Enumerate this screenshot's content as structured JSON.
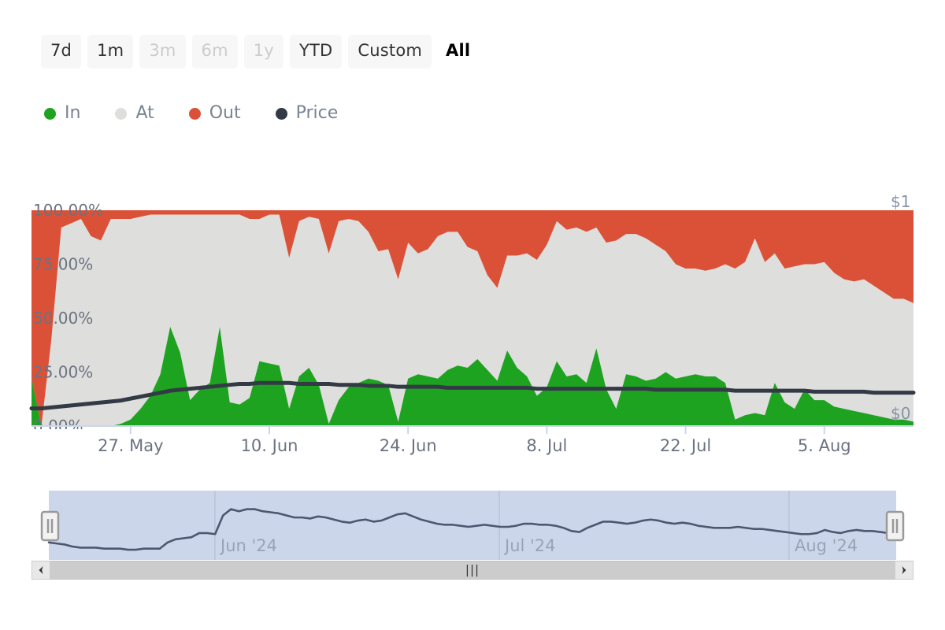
{
  "range_selector": {
    "buttons": [
      {
        "label": "7d",
        "state": "enabled"
      },
      {
        "label": "1m",
        "state": "enabled"
      },
      {
        "label": "3m",
        "state": "disabled"
      },
      {
        "label": "6m",
        "state": "disabled"
      },
      {
        "label": "1y",
        "state": "disabled"
      },
      {
        "label": "YTD",
        "state": "enabled"
      },
      {
        "label": "Custom",
        "state": "enabled"
      },
      {
        "label": "All",
        "state": "selected"
      }
    ]
  },
  "legend": {
    "items": [
      {
        "label": "In",
        "color": "#1ea320",
        "icon": "legend-dot-icon"
      },
      {
        "label": "At",
        "color": "#dededc",
        "icon": "legend-dot-icon"
      },
      {
        "label": "Out",
        "color": "#da5138",
        "icon": "legend-dot-icon"
      },
      {
        "label": "Price",
        "color": "#333a45",
        "icon": "legend-dot-icon"
      }
    ]
  },
  "y_axis": {
    "labels": [
      "0.00%",
      "25.00%",
      "50.00%",
      "75.00%",
      "100.00%"
    ],
    "min": 0,
    "max": 100,
    "unit": "%"
  },
  "price_axis": {
    "top_label": "$1",
    "bottom_label": "$0"
  },
  "x_axis": {
    "labels": [
      "27. May",
      "10. Jun",
      "24. Jun",
      "8. Jul",
      "22. Jul",
      "5. Aug"
    ]
  },
  "navigator": {
    "month_labels": [
      "Jun '24",
      "Jul '24",
      "Aug '24"
    ],
    "left_handle": "||",
    "right_handle": "||",
    "selection_color": "#ccd6eb"
  },
  "scrollbar": {
    "left_arrow": "◄",
    "right_arrow": "►",
    "grip": "|||"
  },
  "colors": {
    "in": "#1ea320",
    "at": "#dededc",
    "out": "#da5138",
    "price": "#333a45",
    "axis_text": "#6b7280",
    "legend_text": "#7b8394",
    "navigator_line": "#4d5870",
    "navigator_fill": "#ccd6eb"
  },
  "chart_data": {
    "type": "area",
    "title": "",
    "subtitle": "",
    "xlabel": "",
    "ylabel": "",
    "ylim": [
      0,
      100
    ],
    "grid": false,
    "stacked": true,
    "stack_type": "percent",
    "legend_position": "top-left",
    "x_tick_labels": [
      "27. May",
      "10. Jun",
      "24. Jun",
      "8. Jul",
      "22. Jul",
      "5. Aug"
    ],
    "y_tick_labels": [
      "0.00%",
      "25.00%",
      "50.00%",
      "75.00%",
      "100.00%"
    ],
    "x": [
      "17. May",
      "18. May",
      "19. May",
      "20. May",
      "21. May",
      "22. May",
      "23. May",
      "24. May",
      "25. May",
      "26. May",
      "27. May",
      "28. May",
      "29. May",
      "30. May",
      "31. May",
      "1. Jun",
      "2. Jun",
      "3. Jun",
      "4. Jun",
      "5. Jun",
      "6. Jun",
      "7. Jun",
      "8. Jun",
      "9. Jun",
      "10. Jun",
      "11. Jun",
      "12. Jun",
      "13. Jun",
      "14. Jun",
      "15. Jun",
      "16. Jun",
      "17. Jun",
      "18. Jun",
      "19. Jun",
      "20. Jun",
      "21. Jun",
      "22. Jun",
      "23. Jun",
      "24. Jun",
      "25. Jun",
      "26. Jun",
      "27. Jun",
      "28. Jun",
      "29. Jun",
      "30. Jun",
      "1. Jul",
      "2. Jul",
      "3. Jul",
      "4. Jul",
      "5. Jul",
      "6. Jul",
      "7. Jul",
      "8. Jul",
      "9. Jul",
      "10. Jul",
      "11. Jul",
      "12. Jul",
      "13. Jul",
      "14. Jul",
      "15. Jul",
      "16. Jul",
      "17. Jul",
      "18. Jul",
      "19. Jul",
      "20. Jul",
      "21. Jul",
      "22. Jul",
      "23. Jul",
      "24. Jul",
      "25. Jul",
      "26. Jul",
      "27. Jul",
      "28. Jul",
      "29. Jul",
      "30. Jul",
      "31. Jul",
      "1. Aug",
      "2. Aug",
      "3. Aug",
      "4. Aug",
      "5. Aug",
      "6. Aug",
      "7. Aug",
      "8. Aug",
      "9. Aug",
      "10. Aug",
      "11. Aug",
      "12. Aug",
      "13. Aug",
      "14. Aug"
    ],
    "series": [
      {
        "name": "In",
        "color": "#1ea320",
        "values": [
          22,
          0,
          0,
          0,
          0,
          0,
          0,
          0,
          0,
          1,
          3,
          8,
          14,
          24,
          46,
          34,
          12,
          17,
          20,
          46,
          11,
          10,
          13,
          30,
          29,
          28,
          8,
          23,
          27,
          19,
          1,
          12,
          18,
          20,
          22,
          21,
          19,
          2,
          22,
          24,
          23,
          22,
          26,
          28,
          27,
          31,
          26,
          21,
          35,
          27,
          23,
          14,
          18,
          30,
          23,
          24,
          20,
          36,
          17,
          8,
          24,
          23,
          21,
          22,
          25,
          22,
          23,
          24,
          23,
          23,
          20,
          3,
          5,
          6,
          5,
          20,
          11,
          8,
          17,
          12,
          12,
          9,
          8,
          7,
          6,
          5,
          4,
          3,
          3,
          2
        ]
      },
      {
        "name": "At",
        "color": "#dededc",
        "values": [
          0,
          0,
          40,
          92,
          94,
          96,
          88,
          86,
          96,
          95,
          93,
          89,
          84,
          74,
          52,
          64,
          86,
          81,
          78,
          52,
          87,
          88,
          83,
          66,
          69,
          70,
          70,
          72,
          70,
          77,
          79,
          83,
          78,
          75,
          68,
          60,
          63,
          66,
          63,
          56,
          59,
          66,
          64,
          62,
          56,
          50,
          44,
          43,
          44,
          52,
          57,
          63,
          66,
          65,
          68,
          68,
          70,
          56,
          68,
          78,
          65,
          66,
          66,
          62,
          56,
          53,
          50,
          49,
          49,
          50,
          55,
          70,
          71,
          81,
          71,
          60,
          62,
          66,
          58,
          63,
          64,
          62,
          60,
          60,
          62,
          60,
          58,
          56,
          56,
          55
        ]
      },
      {
        "name": "Out",
        "color": "#da5138",
        "values": [
          78,
          100,
          60,
          8,
          6,
          4,
          12,
          14,
          4,
          4,
          4,
          3,
          2,
          2,
          2,
          2,
          2,
          2,
          2,
          2,
          2,
          2,
          4,
          4,
          2,
          2,
          22,
          5,
          3,
          4,
          20,
          5,
          4,
          5,
          10,
          19,
          18,
          32,
          15,
          20,
          18,
          12,
          10,
          10,
          17,
          19,
          30,
          36,
          21,
          21,
          20,
          23,
          16,
          5,
          9,
          8,
          10,
          8,
          15,
          14,
          11,
          11,
          13,
          16,
          19,
          25,
          27,
          27,
          28,
          27,
          25,
          27,
          24,
          13,
          24,
          20,
          27,
          26,
          25,
          25,
          24,
          29,
          32,
          33,
          32,
          35,
          38,
          41,
          41,
          43
        ]
      },
      {
        "name": "Price",
        "color": "#333a45",
        "type": "line",
        "axis": "right",
        "values": [
          1.8,
          1.8,
          1.9,
          2.0,
          2.1,
          2.2,
          2.3,
          2.4,
          2.5,
          2.6,
          2.8,
          3.0,
          3.2,
          3.4,
          3.6,
          3.7,
          3.8,
          3.9,
          4.0,
          4.1,
          4.2,
          4.3,
          4.3,
          4.4,
          4.4,
          4.4,
          4.4,
          4.3,
          4.3,
          4.3,
          4.3,
          4.2,
          4.2,
          4.2,
          4.1,
          4.1,
          4.1,
          4.0,
          4.0,
          4.0,
          4.0,
          4.0,
          3.9,
          3.9,
          3.9,
          3.9,
          3.9,
          3.9,
          3.9,
          3.9,
          3.9,
          3.8,
          3.8,
          3.8,
          3.8,
          3.8,
          3.8,
          3.8,
          3.8,
          3.8,
          3.8,
          3.8,
          3.8,
          3.7,
          3.7,
          3.7,
          3.7,
          3.7,
          3.7,
          3.7,
          3.7,
          3.6,
          3.6,
          3.6,
          3.6,
          3.6,
          3.6,
          3.6,
          3.6,
          3.5,
          3.5,
          3.5,
          3.5,
          3.5,
          3.5,
          3.4,
          3.4,
          3.4,
          3.4,
          3.4
        ]
      }
    ],
    "navigator_series": {
      "name": "Price",
      "color": "#4d5870",
      "values": [
        3.0,
        2.9,
        2.8,
        2.6,
        2.5,
        2.5,
        2.5,
        2.4,
        2.4,
        2.4,
        2.3,
        2.3,
        2.4,
        2.4,
        2.4,
        3.0,
        3.3,
        3.4,
        3.5,
        3.9,
        3.9,
        3.8,
        5.6,
        6.2,
        6.0,
        6.2,
        6.2,
        6.0,
        5.9,
        5.8,
        5.6,
        5.4,
        5.4,
        5.3,
        5.5,
        5.4,
        5.2,
        5.0,
        4.9,
        5.1,
        5.2,
        5.0,
        5.1,
        5.4,
        5.7,
        5.8,
        5.5,
        5.2,
        5.0,
        4.8,
        4.7,
        4.7,
        4.6,
        4.5,
        4.6,
        4.7,
        4.6,
        4.5,
        4.5,
        4.6,
        4.8,
        4.8,
        4.7,
        4.7,
        4.6,
        4.4,
        4.1,
        4.0,
        4.4,
        4.7,
        5.0,
        5.0,
        4.9,
        4.8,
        4.9,
        5.1,
        5.2,
        5.1,
        4.9,
        4.8,
        4.9,
        4.8,
        4.6,
        4.5,
        4.4,
        4.4,
        4.4,
        4.5,
        4.4,
        4.3,
        4.3,
        4.2,
        4.1,
        4.0,
        3.9,
        3.8,
        3.8,
        3.9,
        4.2,
        4.0,
        3.9,
        4.1,
        4.2,
        4.1,
        4.1,
        4.0,
        3.9,
        3.9
      ]
    }
  }
}
